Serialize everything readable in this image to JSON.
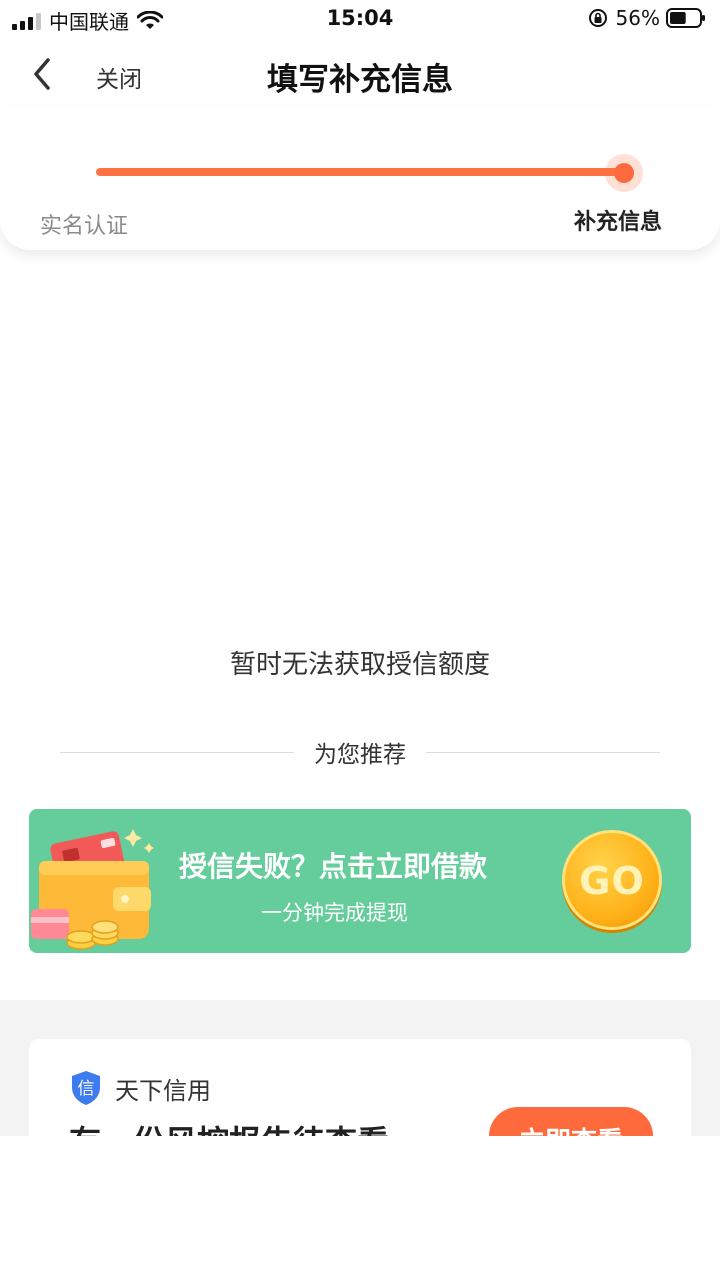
{
  "status_bar": {
    "carrier": "中国联通",
    "time": "15:04",
    "battery_percent": "56%",
    "battery_level": 0.56
  },
  "header": {
    "close_label": "关闭",
    "title": "填写补充信息"
  },
  "progress": {
    "steps": [
      "实名认证",
      "补充信息"
    ],
    "current_step": 2,
    "accent_color": "#ff7043"
  },
  "main": {
    "message": "暂时无法获取授信额度",
    "recommend_label": "为您推荐"
  },
  "banner": {
    "title": "授信失败？点击立即借款",
    "subtitle": "一分钟完成提现",
    "go_label": "GO",
    "background_color": "#65cc9c"
  },
  "credit_card": {
    "brand": "天下信用",
    "brand_icon_char": "信",
    "headline": "有一份风控报告待查看",
    "button_label": "立即查看"
  }
}
